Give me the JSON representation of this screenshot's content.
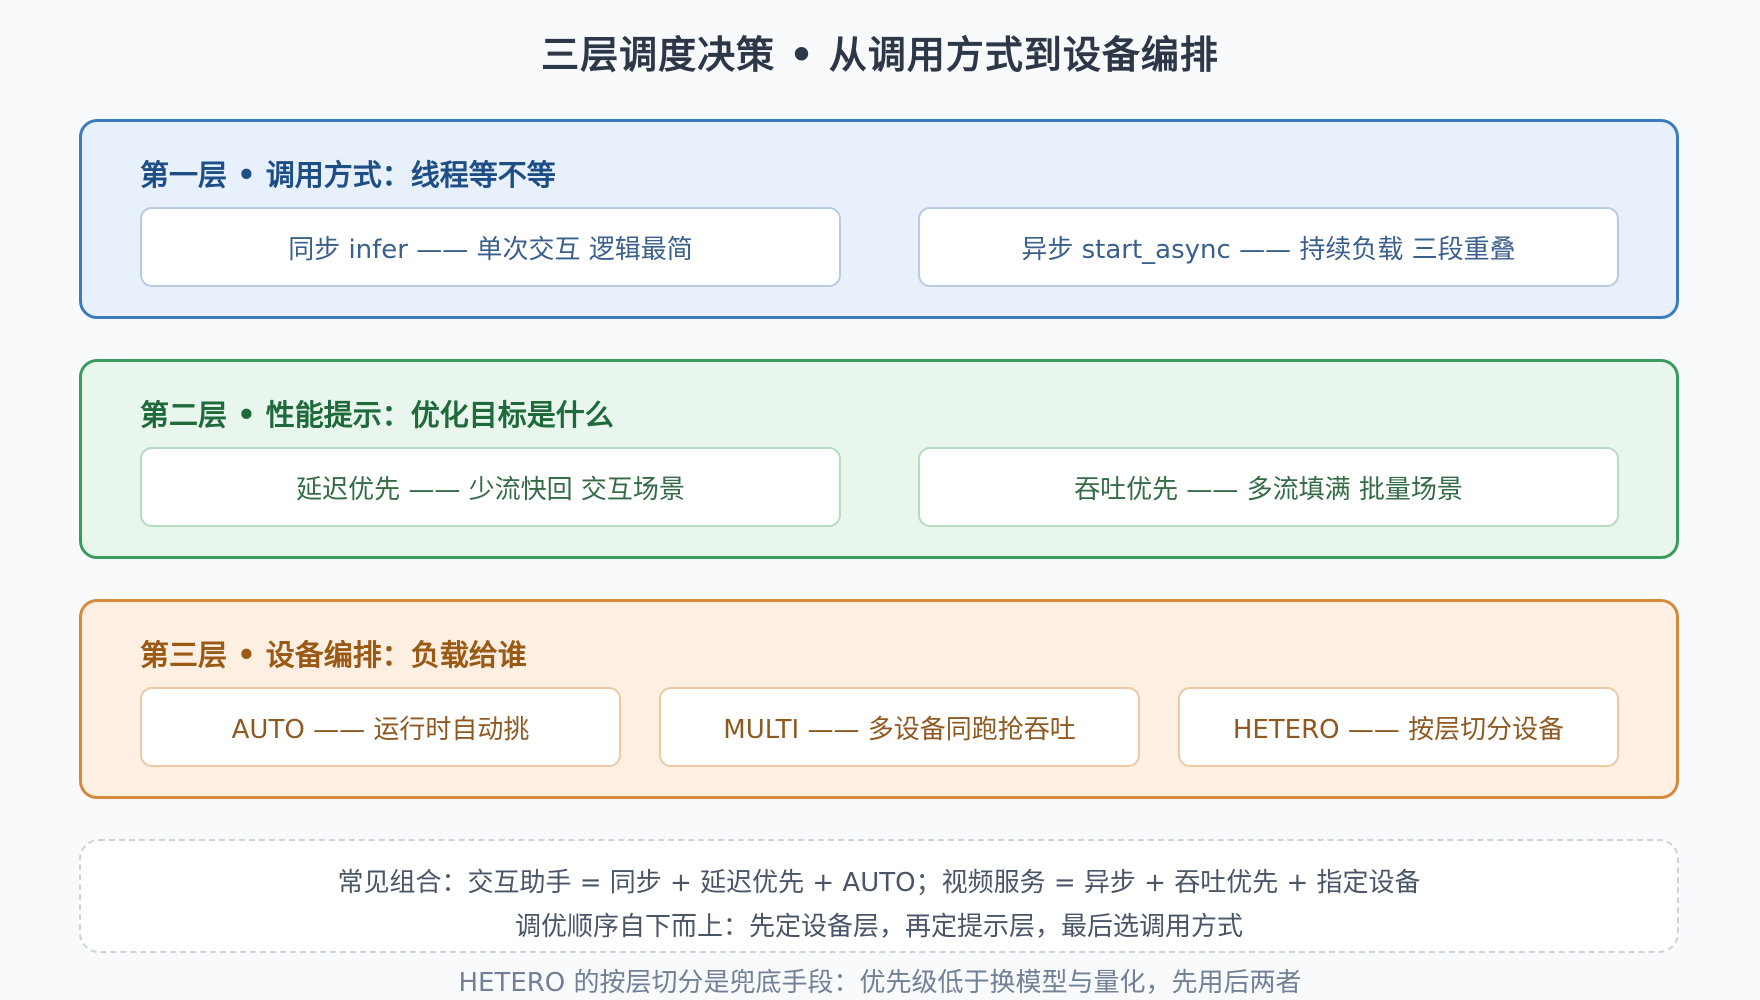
{
  "title": "三层调度决策 • 从调用方式到设备编排",
  "layers": [
    {
      "title": "第一层 • 调用方式：线程等不等",
      "options": [
        "同步 infer —— 单次交互 逻辑最简",
        "异步 start_async —— 持续负载 三段重叠"
      ]
    },
    {
      "title": "第二层 • 性能提示：优化目标是什么",
      "options": [
        "延迟优先 —— 少流快回 交互场景",
        "吞吐优先 —— 多流填满 批量场景"
      ]
    },
    {
      "title": "第三层 • 设备编排：负载给谁",
      "options": [
        "AUTO —— 运行时自动挑",
        "MULTI —— 多设备同跑抢吞吐",
        "HETERO —— 按层切分设备"
      ]
    }
  ],
  "notes": {
    "line1": "常见组合：交互助手 = 同步 + 延迟优先 + AUTO；视频服务 = 异步 + 吞吐优先 + 指定设备",
    "line2": "调优顺序自下而上：先定设备层，再定提示层，最后选调用方式"
  },
  "footnote": "HETERO 的按层切分是兜底手段：优先级低于换模型与量化，先用后两者",
  "colors": {
    "layer1_accent": "#3b7bbf",
    "layer2_accent": "#3b9b5e",
    "layer3_accent": "#d5893c"
  }
}
